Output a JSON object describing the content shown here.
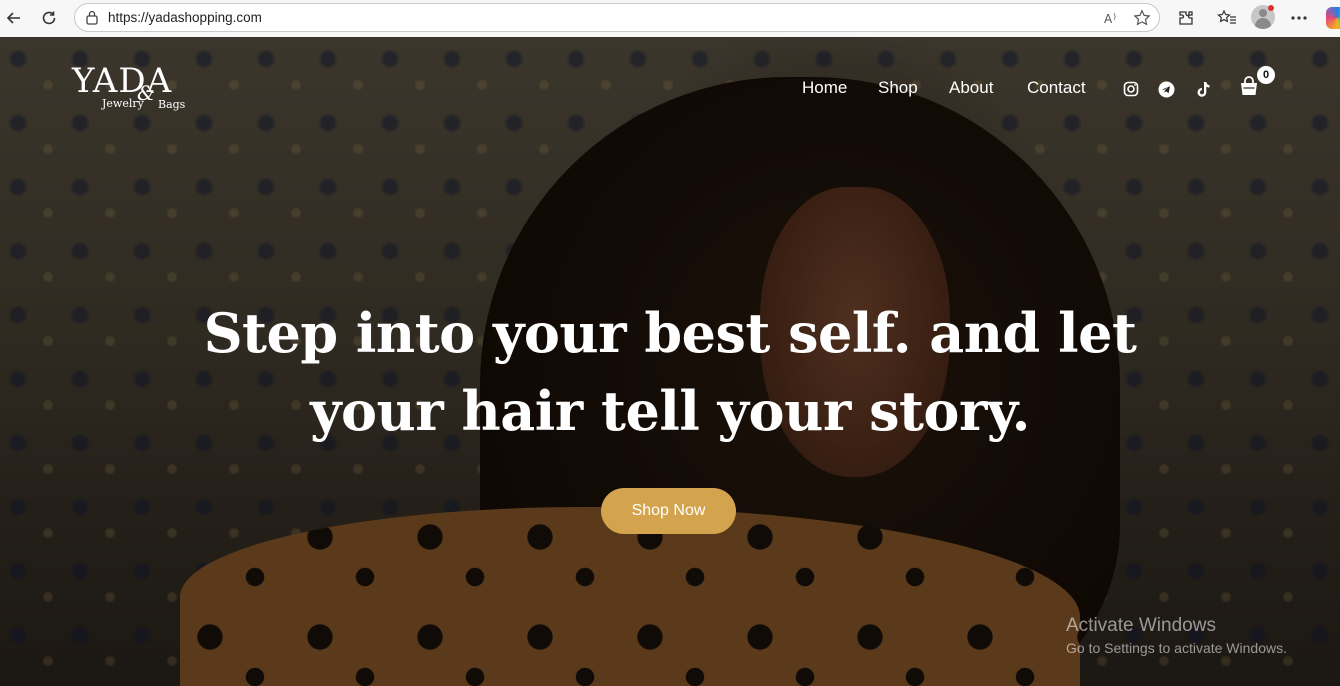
{
  "browser": {
    "url": "https://yadashopping.com"
  },
  "site": {
    "logo": {
      "main": "YADA",
      "ampersand": "&",
      "left_word": "Jewelry",
      "right_word": "Bags"
    },
    "nav": [
      {
        "label": "Home"
      },
      {
        "label": "Shop"
      },
      {
        "label": "About"
      },
      {
        "label": "Contact"
      }
    ],
    "social_icons": [
      "instagram-icon",
      "telegram-icon",
      "tiktok-icon"
    ],
    "cart": {
      "count": "0"
    }
  },
  "hero": {
    "headline_line1": "Step into your best self. and let",
    "headline_line2": "your hair tell your story.",
    "cta_label": "Shop Now",
    "accent_color": "#d4a34e"
  },
  "watermark": {
    "title": "Activate Windows",
    "subtitle": "Go to Settings to activate Windows."
  }
}
